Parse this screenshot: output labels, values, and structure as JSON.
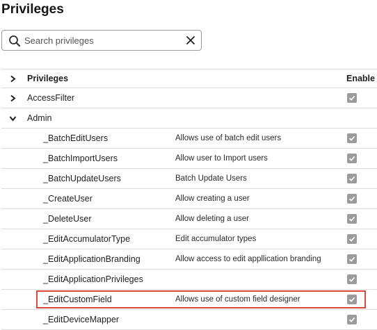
{
  "page": {
    "title": "Privileges"
  },
  "search": {
    "placeholder": "Search privileges",
    "value": ""
  },
  "table": {
    "headers": {
      "privileges": "Privileges",
      "enable": "Enable"
    },
    "groups": [
      {
        "name": "AccessFilter",
        "expanded": false,
        "enabled": true
      },
      {
        "name": "Admin",
        "expanded": true,
        "enabled": null
      }
    ],
    "admin_items": [
      {
        "name": "_BatchEditUsers",
        "description": "Allows use of batch edit users",
        "enabled": true
      },
      {
        "name": "_BatchImportUsers",
        "description": "Allow user to Import users",
        "enabled": true
      },
      {
        "name": "_BatchUpdateUsers",
        "description": "Batch Update Users",
        "enabled": true
      },
      {
        "name": "_CreateUser",
        "description": "Allow creating a user",
        "enabled": true
      },
      {
        "name": "_DeleteUser",
        "description": "Allow deleting a user",
        "enabled": true
      },
      {
        "name": "_EditAccumulatorType",
        "description": "Edit accumulator types",
        "enabled": true
      },
      {
        "name": "_EditApplicationBranding",
        "description": "Allow access to edit appllication branding",
        "enabled": true
      },
      {
        "name": "_EditApplicationPrivileges",
        "description": "",
        "enabled": true
      },
      {
        "name": "_EditCustomField",
        "description": "Allows use of custom field designer",
        "enabled": true,
        "highlighted": true
      },
      {
        "name": "_EditDeviceMapper",
        "description": "",
        "enabled": true
      }
    ]
  },
  "colors": {
    "checkbox": "#9b9b9b",
    "highlight": "#d9483b",
    "divider": "#dcdcdc"
  },
  "icons": {
    "search": "search-icon",
    "clear": "close-icon",
    "collapsed": "chevron-right-icon",
    "expanded": "chevron-down-icon",
    "check": "checkmark-icon"
  }
}
